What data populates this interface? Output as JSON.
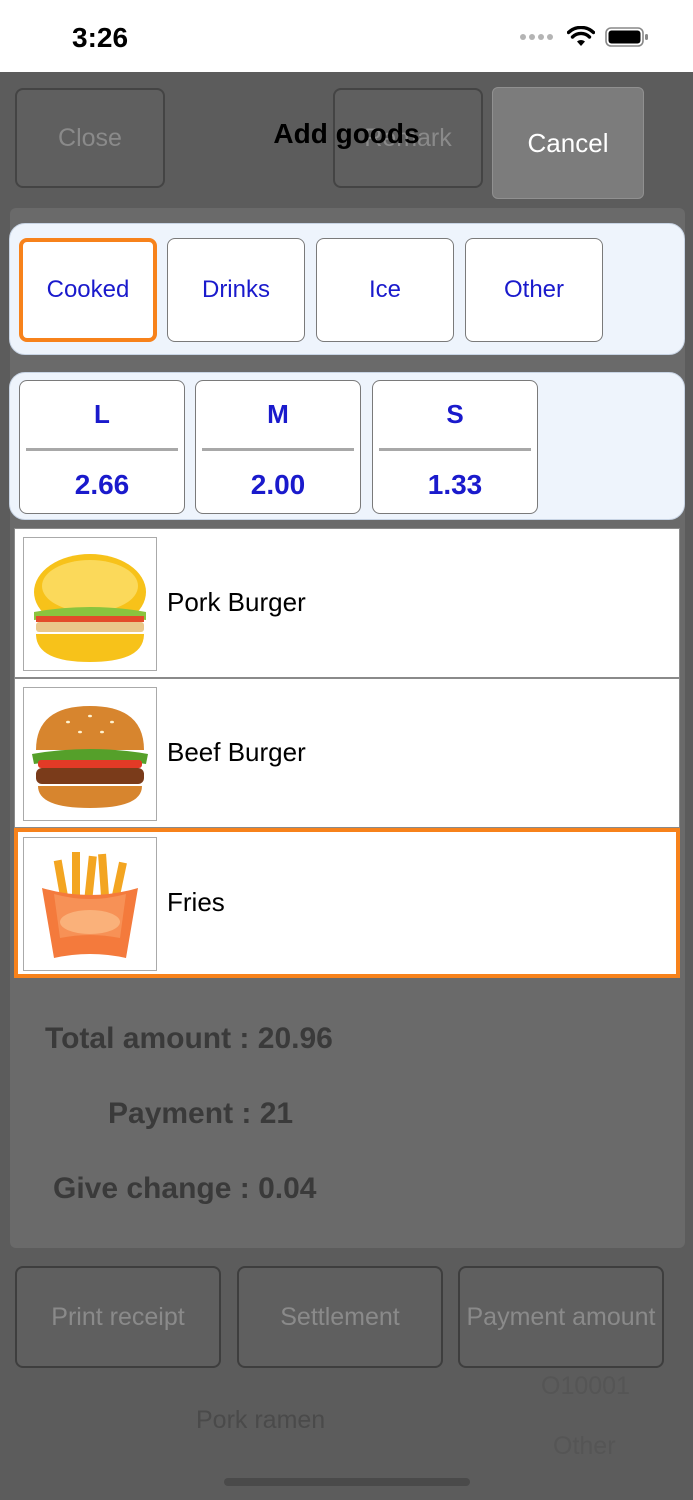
{
  "status_bar": {
    "time": "3:26"
  },
  "background": {
    "close_label": "Close",
    "remark_label": "Remark",
    "print_receipt_label": "Print receipt",
    "settlement_label": "Settlement",
    "payment_amount_label": "Payment amount",
    "total_amount": "Total amount : 20.96",
    "payment": "Payment : 21",
    "give_change": "Give change : 0.04",
    "pork_ramen": "Pork ramen",
    "other": "Other",
    "order_no": "O10001"
  },
  "dialog": {
    "title": "Add goods",
    "cancel_label": "Cancel",
    "categories": [
      {
        "label": "Cooked",
        "selected": true
      },
      {
        "label": "Drinks",
        "selected": false
      },
      {
        "label": "Ice",
        "selected": false
      },
      {
        "label": "Other",
        "selected": false
      }
    ],
    "sizes": [
      {
        "name": "L",
        "price": "2.66"
      },
      {
        "name": "M",
        "price": "2.00"
      },
      {
        "name": "S",
        "price": "1.33"
      }
    ],
    "goods": [
      {
        "name": "Pork Burger",
        "icon": "pork-burger-image",
        "selected": false
      },
      {
        "name": "Beef Burger",
        "icon": "beef-burger-image",
        "selected": false
      },
      {
        "name": "Fries",
        "icon": "fries-image",
        "selected": true
      }
    ]
  },
  "colors": {
    "accent": "#f7821b",
    "text_blue": "#1a1acc",
    "overlay": "#5e5e5e"
  }
}
